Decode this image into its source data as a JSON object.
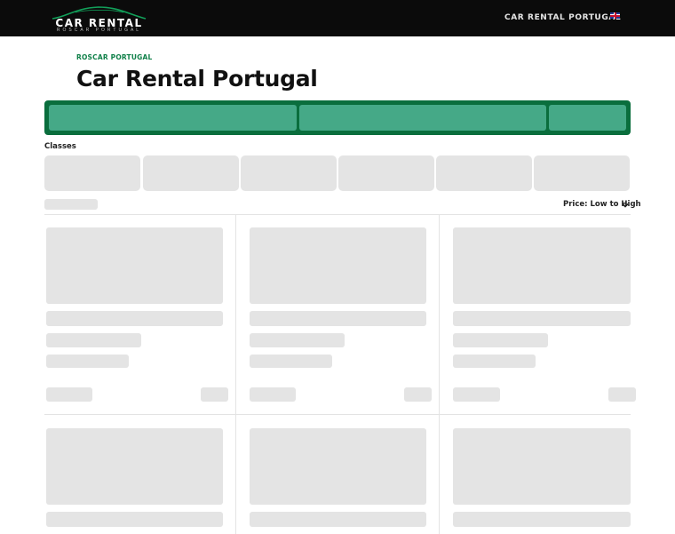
{
  "header": {
    "logo_text": "CAR RENTAL",
    "logo_subtext": "ROSCAR PORTUGAL",
    "nav_link": "CAR RENTAL PORTUGAL",
    "language_flag": "uk-flag-icon"
  },
  "breadcrumb": "ROSCAR PORTUGAL",
  "page_title": "Car Rental Portugal",
  "search": {
    "fields": 3,
    "accent": "#0a6e3d",
    "field_color": "#45a987"
  },
  "classes": {
    "label": "Classes",
    "tiles": 6
  },
  "sort": {
    "label": "Price: Low to High",
    "icon": "chevron-down-icon"
  },
  "results": {
    "columns": 3,
    "rows_visible": 2
  },
  "colors": {
    "topbar": "#0b0b0b",
    "brand_green": "#11814a",
    "skeleton": "#e4e4e4"
  }
}
